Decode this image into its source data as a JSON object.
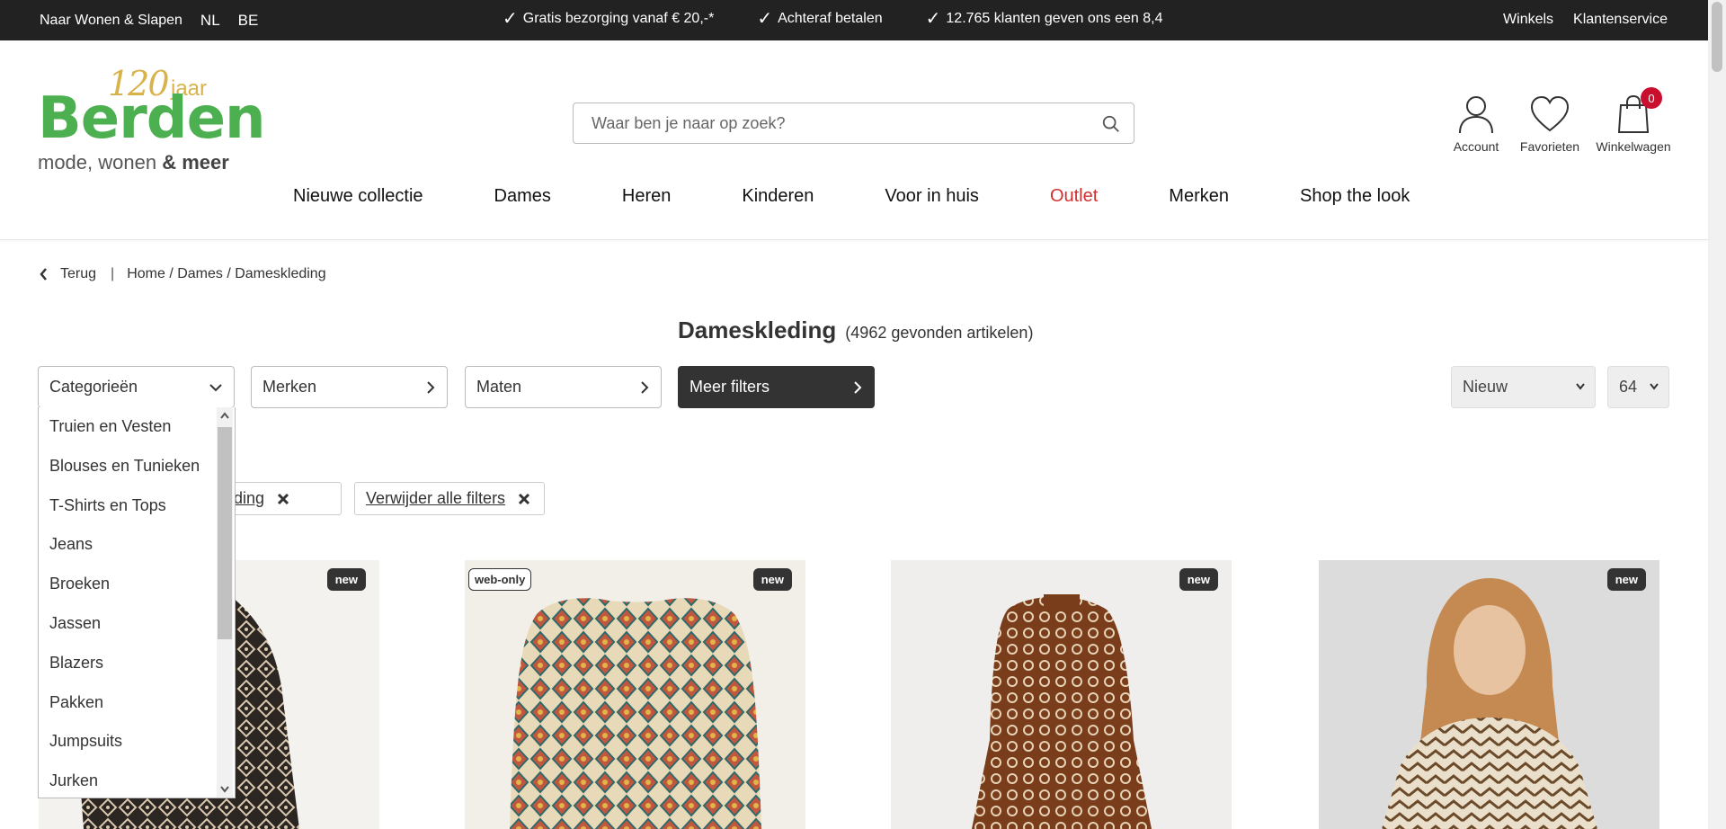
{
  "topbar": {
    "sleep_link": "Naar Wonen & Slapen",
    "lang_nl": "NL",
    "lang_be": "BE",
    "usps": [
      "Gratis bezorging vanaf € 20,-*",
      "Achteraf betalen",
      "12.765 klanten geven ons een 8,4"
    ],
    "stores": "Winkels",
    "service": "Klantenservice"
  },
  "logo": {
    "years": "120",
    "jaar": "jaar",
    "brand": "Berden",
    "tag_prefix": "mode, wonen ",
    "tag_amp": "&",
    "tag_meer": " meer"
  },
  "search": {
    "placeholder": "Waar ben je naar op zoek?"
  },
  "account": {
    "label": "Account"
  },
  "favorites": {
    "label": "Favorieten"
  },
  "cart": {
    "label": "Winkelwagen",
    "count": "0"
  },
  "nav": {
    "items": [
      "Nieuwe collectie",
      "Dames",
      "Heren",
      "Kinderen",
      "Voor in huis",
      "Outlet",
      "Merken",
      "Shop the look"
    ]
  },
  "breadcrumb": {
    "back": "Terug",
    "separator": "|",
    "path": "Home / Dames / Dameskleding"
  },
  "page": {
    "title": "Dameskleding",
    "count": "(4962 gevonden artikelen)"
  },
  "filters": {
    "categories": "Categorieën",
    "brands": "Merken",
    "sizes": "Maten",
    "more": "Meer filters"
  },
  "sort": {
    "order": "Nieuw",
    "per_page": "64"
  },
  "chips": {
    "category": "meskleding",
    "clear_all": "Verwijder alle filters"
  },
  "dropdown": {
    "items": [
      "Truien en Vesten",
      "Blouses en Tunieken",
      "T-Shirts en Tops",
      "Jeans",
      "Broeken",
      "Jassen",
      "Blazers",
      "Pakken",
      "Jumpsuits",
      "Jurken"
    ]
  },
  "products": [
    {
      "badge_new": "new"
    },
    {
      "badge_web": "web-only",
      "badge_new": "new"
    },
    {
      "badge_new": "new"
    },
    {
      "badge_new": "new"
    }
  ],
  "colors": {
    "brand_green": "#4caf50",
    "brand_gold": "#d8b24a",
    "topbar": "#222222",
    "outlet": "#d32f2f",
    "badge": "#c8102e"
  }
}
